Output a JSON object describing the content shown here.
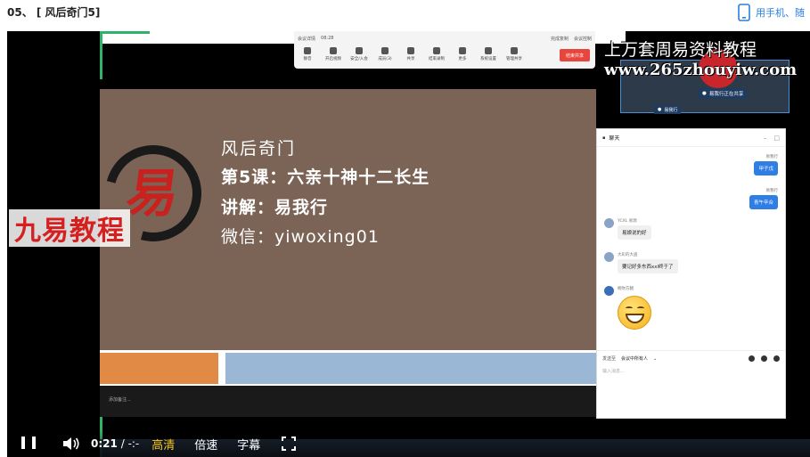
{
  "page": {
    "title": "05、 [ 风后奇门5]",
    "mobile_link": "用手机、随"
  },
  "meeting_toolbar": {
    "status_items": [
      "会议详情",
      "08:28"
    ],
    "right_items": [
      "完成复制",
      "会议控制"
    ],
    "buttons": [
      "静音",
      "开启视频",
      "安全/入会",
      "成员(3)",
      "共享",
      "结束录制",
      "更多",
      "系统设置",
      "管理共享"
    ],
    "end_label": "结束共享"
  },
  "watermark": {
    "line1": "上万套周易资料教程",
    "line2": "www.265zhouyiw.com"
  },
  "participants": {
    "main_tag": "易我行正在共享",
    "second_tag": "易我行"
  },
  "slide": {
    "logo_char": "易",
    "line1": "风后奇门",
    "line2": "第5课：六亲十神十二长生",
    "line3": "讲解：易我行",
    "line4": "微信：yiwoxing01",
    "footer": "添加备注..."
  },
  "brand_overlay": "九易教程",
  "chat": {
    "title": "聊天",
    "messages": [
      {
        "side": "right",
        "who": "易我行",
        "text": "甲子戊"
      },
      {
        "side": "right",
        "who": "易我行",
        "text": "青午辛合"
      },
      {
        "side": "left",
        "who": "YCXL 易源",
        "text": "易娘说的好"
      },
      {
        "side": "left",
        "who": "大彩的大盗",
        "text": "要记好多东西xxl终于了"
      },
      {
        "side": "left",
        "who": "桐你方翻",
        "text": ""
      }
    ],
    "send_to_label": "发送至",
    "send_to_value": "会议中所有人",
    "input_placeholder": "输入消息..."
  },
  "player": {
    "time_current": "0:21",
    "time_separator": "/",
    "time_total": "-:-",
    "quality": "高清",
    "speed": "倍速",
    "subtitles": "字幕"
  },
  "colors": {
    "slide_bg": "#7b6456",
    "accent_orange": "#e08a45",
    "accent_blue": "#9ab7d6",
    "brand_red": "#d62020",
    "link_blue": "#2b7fe0",
    "quality_yellow": "#f5c518"
  }
}
